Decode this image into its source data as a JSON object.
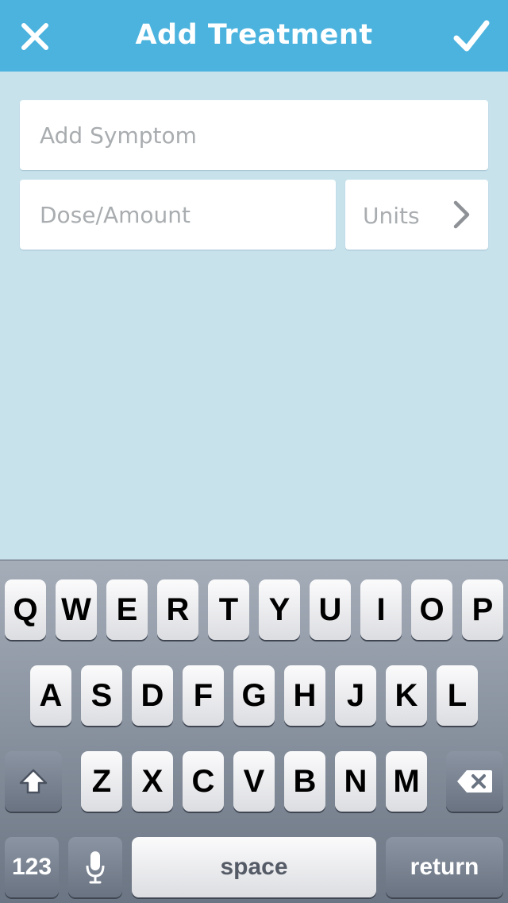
{
  "header": {
    "title": "Add Treatment",
    "close_icon": "close-icon",
    "confirm_icon": "checkmark-icon",
    "background": "#4bb3de"
  },
  "form": {
    "symptom_placeholder": "Add Symptom",
    "symptom_value": "",
    "dose_placeholder": "Dose/Amount",
    "dose_value": "",
    "units_label": "Units",
    "units_icon": "chevron-right-icon"
  },
  "keyboard": {
    "row1": [
      "Q",
      "W",
      "E",
      "R",
      "T",
      "Y",
      "U",
      "I",
      "O",
      "P"
    ],
    "row2": [
      "A",
      "S",
      "D",
      "F",
      "G",
      "H",
      "J",
      "K",
      "L"
    ],
    "row3": [
      "Z",
      "X",
      "C",
      "V",
      "B",
      "N",
      "M"
    ],
    "shift_icon": "shift-icon",
    "delete_icon": "backspace-icon",
    "numbers_label": "123",
    "mic_icon": "microphone-icon",
    "space_label": "space",
    "return_label": "return"
  },
  "colors": {
    "background": "#c8e2ec",
    "field": "#ffffff",
    "placeholder": "#a9adb0"
  }
}
